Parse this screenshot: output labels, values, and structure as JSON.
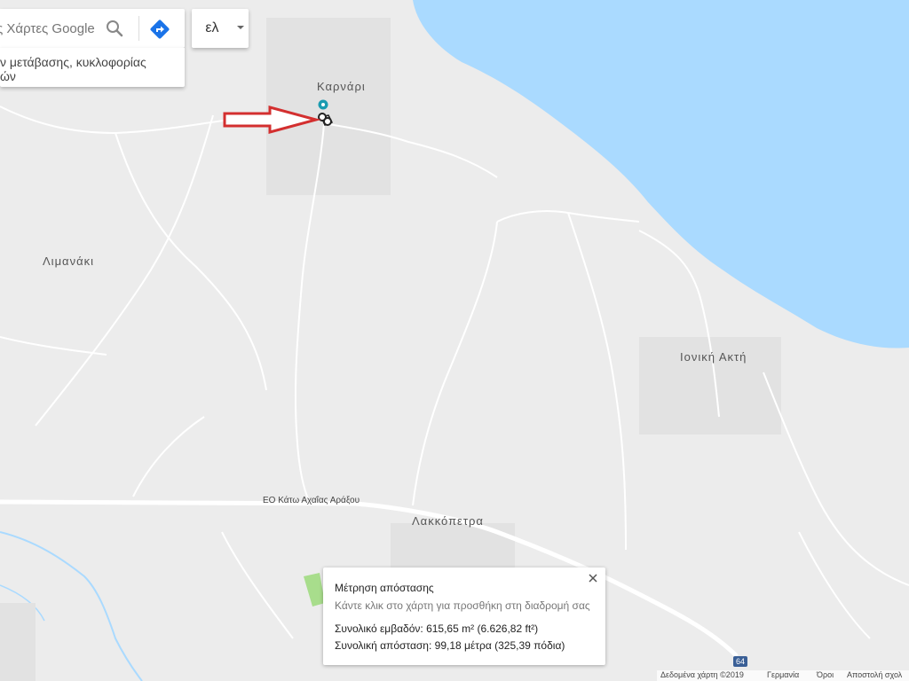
{
  "search": {
    "placeholder": "ς Χάρτες Google",
    "search_icon": "search-icon",
    "directions_icon": "directions-icon"
  },
  "suggestion": {
    "line1": "ν μετάβασης, κυκλοφορίας",
    "line2": "ών"
  },
  "language": {
    "label": "ελ",
    "dropdown_icon": "caret-down-icon"
  },
  "places": {
    "karnari": "Καρνάρι",
    "limanaki": "Λιμανάκι",
    "ioniki_akti": "Ιονική Ακτή",
    "lakkopetra": "Λακκόπετρα",
    "road_eo": "ΕΟ Κάτω Αχαΐας Αράξου",
    "road_shield": "64"
  },
  "measure": {
    "title": "Μέτρηση απόστασης",
    "hint": "Κάντε κλικ στο χάρτη για προσθήκη στη διαδρομή σας",
    "area": "Συνολικό εμβαδόν: 615,65 m² (6.626,82 ft²)",
    "distance": "Συνολική απόσταση: 99,18 μέτρα (325,39 πόδια)",
    "close_icon": "close-icon"
  },
  "footer": {
    "data": "Δεδομένα χάρτη ©2019",
    "country": "Γερμανία",
    "terms": "Όροι",
    "feedback": "Αποστολή σχολ"
  },
  "colors": {
    "water": "#aadaff",
    "land": "#ececec",
    "road": "#ffffff",
    "arrow": "#d32f2f",
    "marker": "#1a9bb0",
    "park": "#a8dd8c"
  }
}
